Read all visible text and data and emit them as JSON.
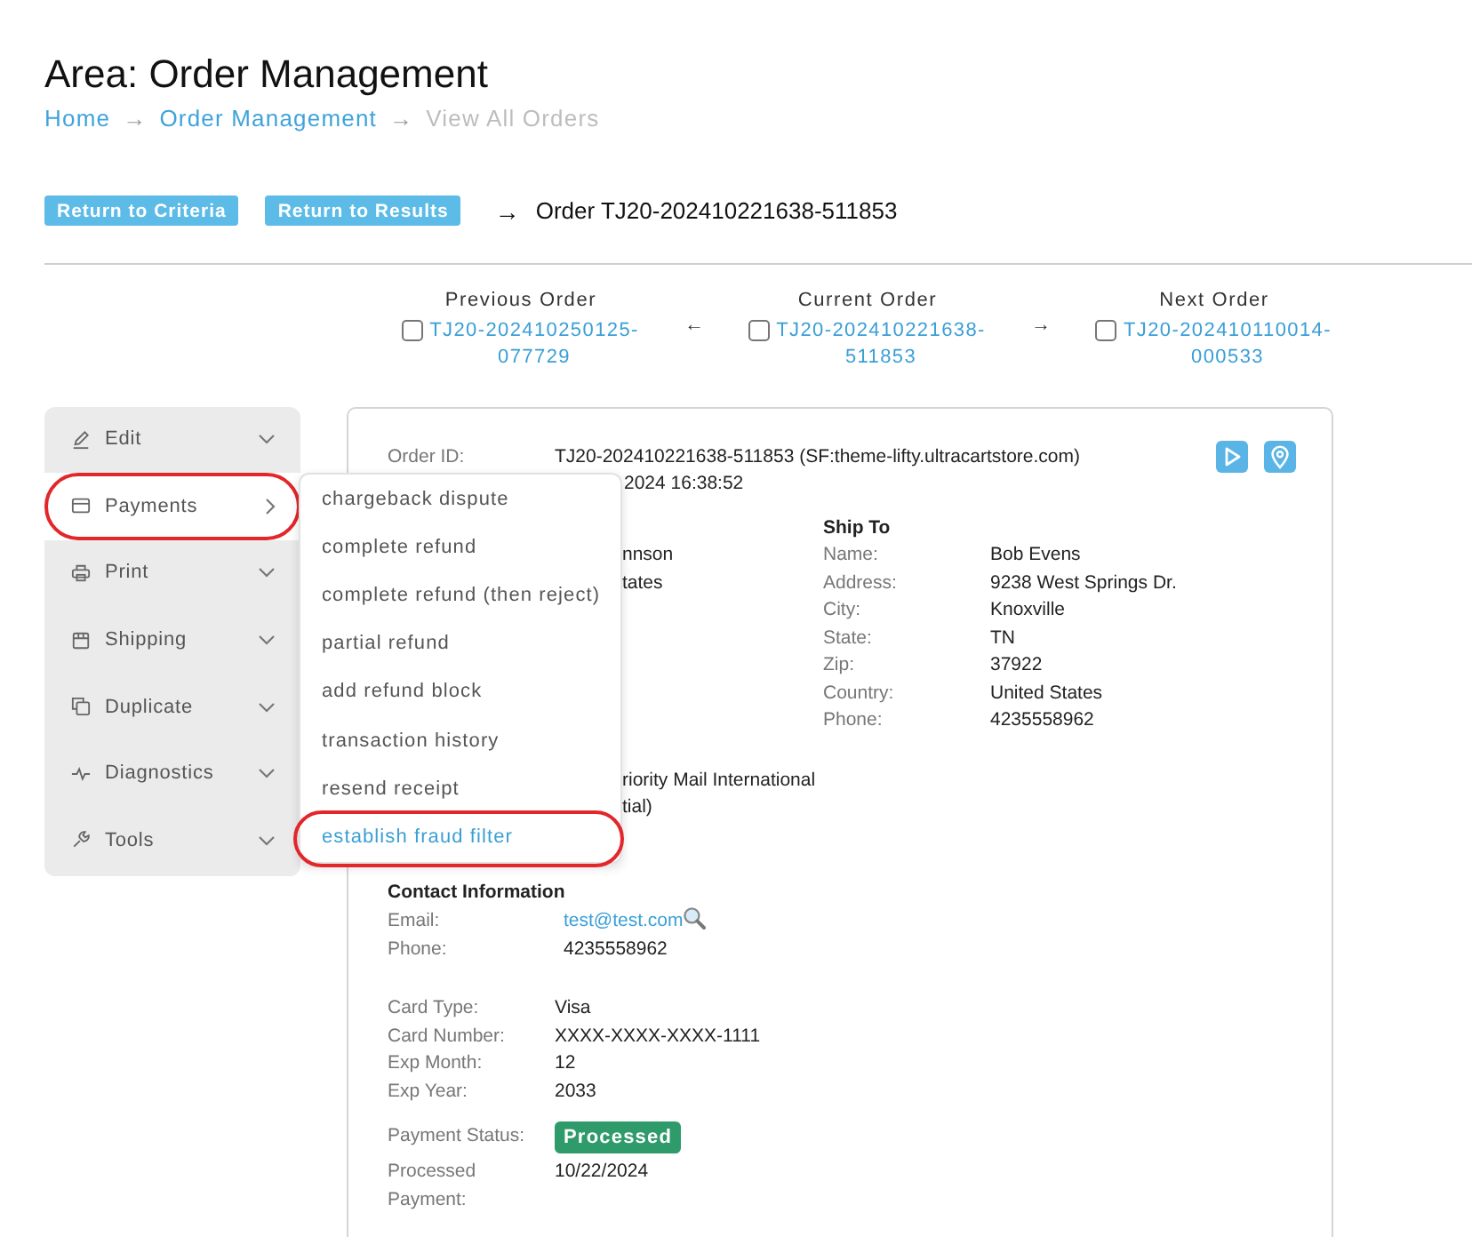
{
  "header": {
    "title": "Area: Order Management",
    "breadcrumbs": [
      {
        "label": "Home",
        "kind": "link"
      },
      {
        "label": "→",
        "kind": "separator"
      },
      {
        "label": "Order Management",
        "kind": "link"
      },
      {
        "label": "→",
        "kind": "separator"
      },
      {
        "label": "View All Orders",
        "kind": "current"
      }
    ]
  },
  "toolbar": {
    "buttons": [
      "Return to Criteria",
      "Return to Results"
    ],
    "arrow": "→",
    "order_title": "Order TJ20-202410221638-511853"
  },
  "order_nav": {
    "columns": [
      {
        "heading": "Previous Order",
        "checked": false,
        "link": "TJ20-202410250125-077729"
      },
      {
        "heading": "Current Order",
        "checked": false,
        "link": "TJ20-202410221638-511853"
      },
      {
        "heading": "Next Order",
        "checked": false,
        "link": "TJ20-202410110014-000533"
      }
    ],
    "arrows": [
      "←",
      "→"
    ]
  },
  "sidebar": {
    "items": [
      {
        "label": "Edit",
        "selected": false,
        "circled": false
      },
      {
        "label": "Payments",
        "selected": true,
        "circled": true
      },
      {
        "label": "Print",
        "selected": false,
        "circled": false
      },
      {
        "label": "Shipping",
        "selected": false,
        "circled": false
      },
      {
        "label": "Duplicate",
        "selected": false,
        "circled": false
      },
      {
        "label": "Diagnostics",
        "selected": false,
        "circled": false
      },
      {
        "label": "Tools",
        "selected": false,
        "circled": false
      }
    ],
    "flyout": {
      "items": [
        {
          "label": "chargeback dispute",
          "selected": false,
          "circled": false
        },
        {
          "label": "complete refund",
          "selected": false,
          "circled": false
        },
        {
          "label": "complete refund (then reject)",
          "selected": false,
          "circled": false
        },
        {
          "label": "partial refund",
          "selected": false,
          "circled": false
        },
        {
          "label": "add refund block",
          "selected": false,
          "circled": false
        },
        {
          "label": "transaction history",
          "selected": false,
          "circled": false
        },
        {
          "label": "resend receipt",
          "selected": false,
          "circled": false
        },
        {
          "label": "establish fraud filter",
          "selected": true,
          "circled": true
        }
      ]
    }
  },
  "order_card": {
    "order_id": {
      "label": "Order ID:",
      "value": "TJ20-202410221638-511853 (SF:theme-lifty.ultracartstore.com)"
    },
    "date_fragment": "2024 16:38:52",
    "bill_to_fragments": [
      "nnson",
      "tates"
    ],
    "ship_to": {
      "heading": "Ship To",
      "fields": [
        {
          "label": "Name:",
          "value": "Bob Evens"
        },
        {
          "label": "Address:",
          "value": "9238 West Springs Dr."
        },
        {
          "label": "City:",
          "value": "Knoxville"
        },
        {
          "label": "State:",
          "value": "TN"
        },
        {
          "label": "Zip:",
          "value": "37922"
        },
        {
          "label": "Country:",
          "value": "United States"
        },
        {
          "label": "Phone:",
          "value": "4235558962"
        }
      ]
    },
    "shipping_fragments": [
      "riority Mail International",
      "tial)"
    ],
    "contact": {
      "heading": "Contact Information",
      "fields": [
        {
          "label": "Email:",
          "value": "test@test.com",
          "kind": "email"
        },
        {
          "label": "Phone:",
          "value": "4235558962",
          "kind": "text"
        }
      ]
    },
    "card_fields": [
      {
        "label": "Card Type:",
        "value": "Visa"
      },
      {
        "label": "Card Number:",
        "value": "XXXX-XXXX-XXXX-1111"
      },
      {
        "label": "Exp Month:",
        "value": "12"
      },
      {
        "label": "Exp Year:",
        "value": "2033"
      }
    ],
    "payment_fields": [
      {
        "label": "Payment Status:",
        "value": "Processed",
        "kind": "badge"
      },
      {
        "label": "Processed Payment:",
        "value": "10/22/2024",
        "kind": "text"
      }
    ]
  }
}
